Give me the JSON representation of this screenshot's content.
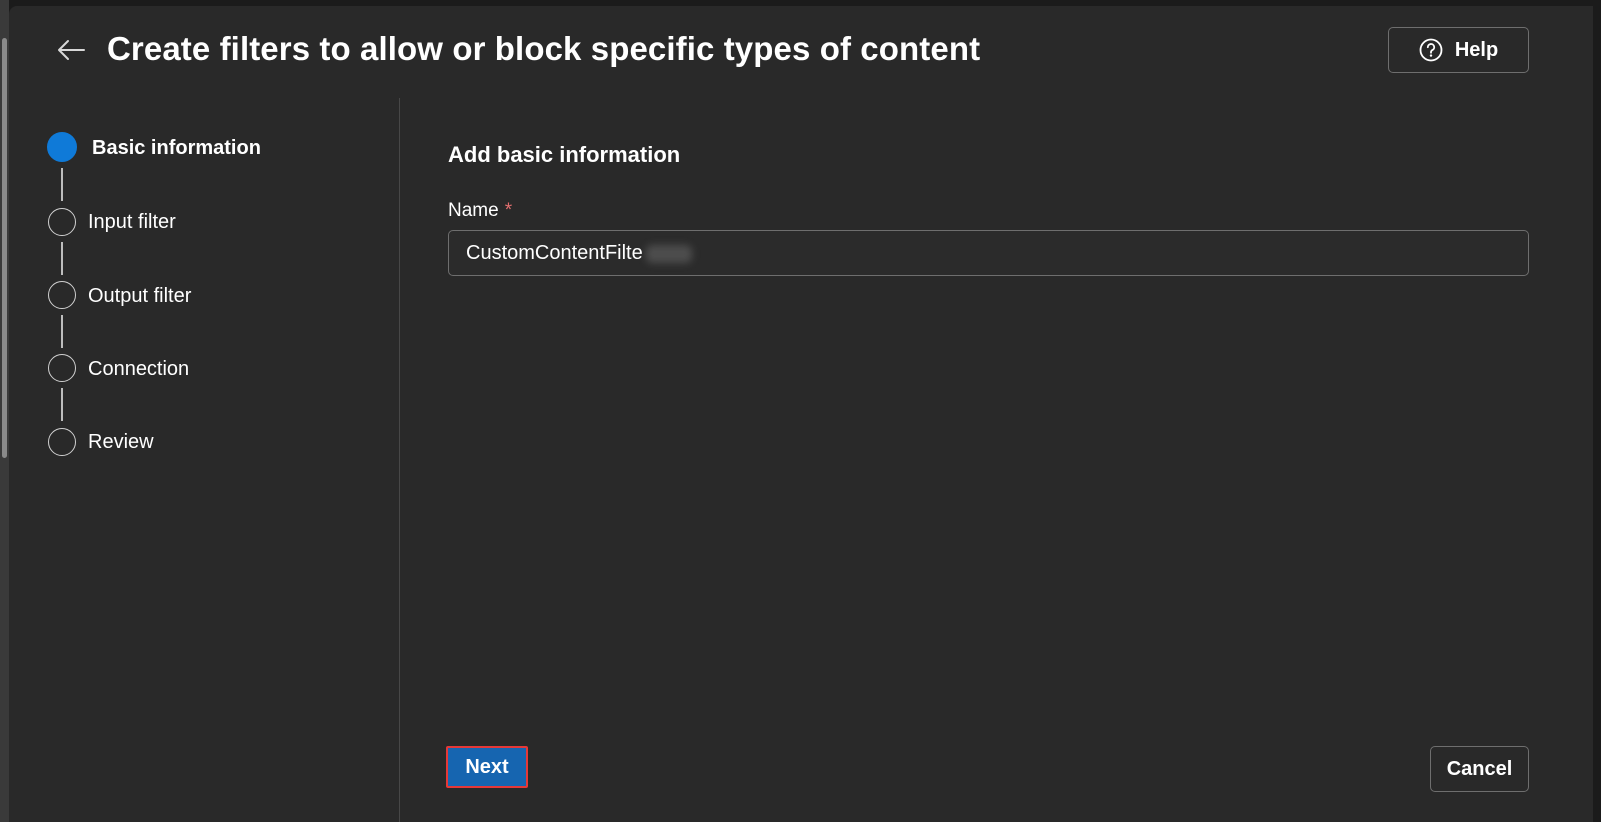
{
  "header": {
    "title": "Create filters to allow or block specific types of content",
    "back_icon": "arrow-left-icon",
    "help_label": "Help",
    "help_icon": "question-circle-icon"
  },
  "steps": [
    {
      "label": "Basic information",
      "state": "active"
    },
    {
      "label": "Input filter",
      "state": "pending"
    },
    {
      "label": "Output filter",
      "state": "pending"
    },
    {
      "label": "Connection",
      "state": "pending"
    },
    {
      "label": "Review",
      "state": "pending"
    }
  ],
  "main": {
    "section_title": "Add basic information",
    "name_label": "Name",
    "required_mark": "*",
    "name_value": "CustomContentFilte"
  },
  "footer": {
    "next_label": "Next",
    "cancel_label": "Cancel"
  },
  "colors": {
    "accent": "#0f7ad8",
    "primary_button": "#1665b0",
    "highlight_border": "#e53838",
    "panel_bg": "#292929",
    "required": "#e36f6f"
  }
}
